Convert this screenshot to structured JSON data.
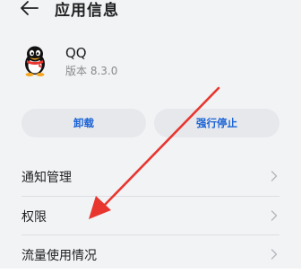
{
  "header": {
    "title": "应用信息",
    "back_icon": "arrow-left-icon"
  },
  "app": {
    "name": "QQ",
    "version": "版本 8.3.0",
    "icon": "qq-penguin-icon"
  },
  "buttons": {
    "uninstall": "卸载",
    "force_stop": "强行停止",
    "accent": "#1b63d6"
  },
  "list": {
    "items": [
      {
        "label": "通知管理"
      },
      {
        "label": "权限"
      },
      {
        "label": "流量使用情况"
      }
    ],
    "chevron_icon": "chevron-right-icon"
  },
  "annotation": {
    "icon": "red-arrow-annotation",
    "color": "#e8362f"
  }
}
